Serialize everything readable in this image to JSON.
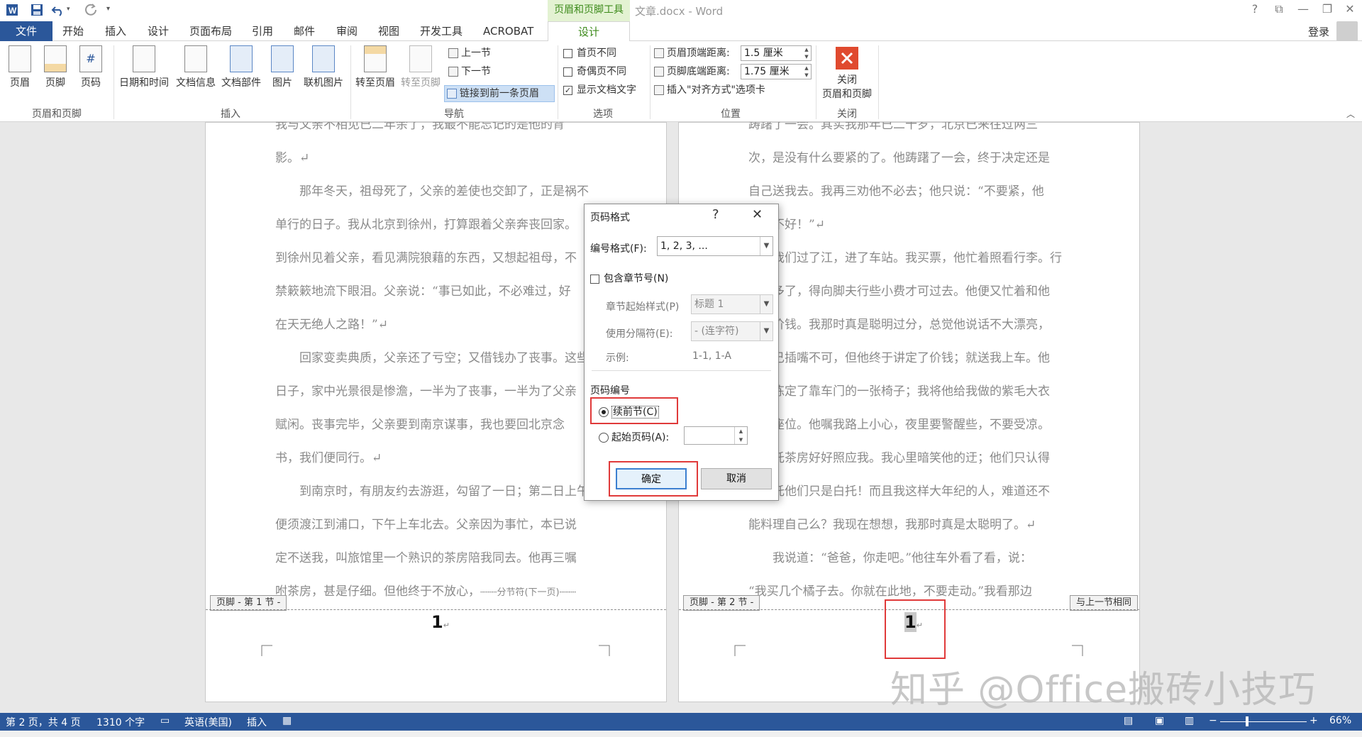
{
  "titlebar": {
    "doc_title": "文章.docx - Word",
    "context_tab": "页眉和页脚工具",
    "minimize": "—",
    "restore": "❐",
    "close": "✕",
    "help": "?",
    "ribbon_display": "⧉"
  },
  "tabs": {
    "file": "文件",
    "home": "开始",
    "insert": "插入",
    "design": "设计",
    "layout": "页面布局",
    "references": "引用",
    "mailings": "邮件",
    "review": "审阅",
    "view": "视图",
    "developer": "开发工具",
    "acrobat": "ACROBAT",
    "hf_design": "设计",
    "login": "登录"
  },
  "ribbon": {
    "hf_group": {
      "label": "页眉和页脚",
      "header": "页眉",
      "footer": "页脚",
      "page_number": "页码"
    },
    "insert_group": {
      "label": "插入",
      "datetime": "日期和时间",
      "docinfo": "文档信息",
      "quickparts": "文档部件",
      "picture": "图片",
      "online_picture": "联机图片"
    },
    "nav_group": {
      "label": "导航",
      "goto_header": "转至页眉",
      "goto_footer": "转至页脚",
      "prev": "上一节",
      "next": "下一节",
      "link_prev": "链接到前一条页眉"
    },
    "options_group": {
      "label": "选项",
      "diff_first": "首页不同",
      "diff_oddeven": "奇偶页不同",
      "show_doc_text": "显示文档文字"
    },
    "position_group": {
      "label": "位置",
      "header_top": "页眉顶端距离:",
      "header_top_val": "1.5 厘米",
      "footer_bottom": "页脚底端距离:",
      "footer_bottom_val": "1.75 厘米",
      "insert_align_tab": "插入\"对齐方式\"选项卡"
    },
    "close_group": {
      "label": "关闭",
      "close_btn_line1": "关闭",
      "close_btn_line2": "页眉和页脚"
    }
  },
  "page1": {
    "lines": [
      "我与父亲不相见已二年余了，我最不能忘记的是他的背",
      "影。↵",
      "　　那年冬天，祖母死了，父亲的差使也交卸了，正是祸不",
      "单行的日子。我从北京到徐州，打算跟着父亲奔丧回家。",
      "到徐州见着父亲，看见满院狼藉的东西，又想起祖母，不",
      "禁簌簌地流下眼泪。父亲说：“事已如此，不必难过，好",
      "在天无绝人之路！”↵",
      "　　回家变卖典质，父亲还了亏空；又借钱办了丧事。这些",
      "日子，家中光景很是惨澹，一半为了丧事，一半为了父亲",
      "赋闲。丧事完毕，父亲要到南京谋事，我也要回北京念",
      "书，我们便同行。↵",
      "　　到南京时，有朋友约去游逛，勾留了一日；第二日上午",
      "便须渡江到浦口，下午上车北去。父亲因为事忙，本已说",
      "定不送我，叫旅馆里一个熟识的茶房陪我同去。他再三嘱",
      "咐茶房，甚是仔细。但他终于不放心，"
    ],
    "section_break": "分节符(下一页)",
    "footer_tag": "页脚 - 第 1 节 -",
    "page_number": "1"
  },
  "page2": {
    "lines": [
      "踌躇了一会。其实我那年已二十岁，北京已来往过两三",
      "次，是没有什么要紧的了。他踌躇了一会，终于决定还是",
      "自己送我去。我再三劝他不必去；他只说：“不要紧，他",
      "们去不好！”↵",
      "　　我们过了江，进了车站。我买票，他忙着照看行李。行",
      "李太多了，得向脚夫行些小费才可过去。他便又忙着和他",
      "们讲价钱。我那时真是聪明过分，总觉他说话不大漂亮，",
      "非自己插嘴不可，但他终于讲定了价钱；就送我上车。他",
      "给我拣定了靠车门的一张椅子；我将他给我做的紫毛大衣",
      "铺好座位。他嘱我路上小心，夜里要警醒些，不要受凉。",
      "又嘱托茶房好好照应我。我心里暗笑他的迂；他们只认得",
      "钱，托他们只是白托！而且我这样大年纪的人，难道还不",
      "能料理自己么？我现在想想，我那时真是太聪明了。↵",
      "　　我说道：“爸爸，你走吧。”他往车外看了看，说：",
      "“我买几个橘子去。你就在此地，不要走动。”我看那边"
    ],
    "footer_tag": "页脚 - 第 2 节 -",
    "same_as_prev": "与上一节相同",
    "page_number": "1"
  },
  "dialog": {
    "title": "页码格式",
    "help": "?",
    "close": "✕",
    "number_format_label": "编号格式(F):",
    "number_format_value": "1, 2, 3, ...",
    "include_chapter": "包含章节号(N)",
    "chapter_style_label": "章节起始样式(P)",
    "chapter_style_value": "标题 1",
    "separator_label": "使用分隔符(E):",
    "separator_value": "-  (连字符)",
    "example_label": "示例:",
    "example_value": "1-1, 1-A",
    "numbering_group": "页码编号",
    "continue_prev": "续前节(C)",
    "start_at": "起始页码(A):",
    "start_at_value": "",
    "ok": "确定",
    "cancel": "取消"
  },
  "statusbar": {
    "page": "第 2 页，共 4 页",
    "words": "1310 个字",
    "language": "英语(美国)",
    "mode": "插入",
    "zoom": "66%",
    "zoom_minus": "−",
    "zoom_plus": "+"
  },
  "watermark": "知乎 @Office搬砖小技巧",
  "colors": {
    "accent": "#2b579a",
    "context_green": "#3c8a1a",
    "highlight_red": "#e03a3a"
  }
}
